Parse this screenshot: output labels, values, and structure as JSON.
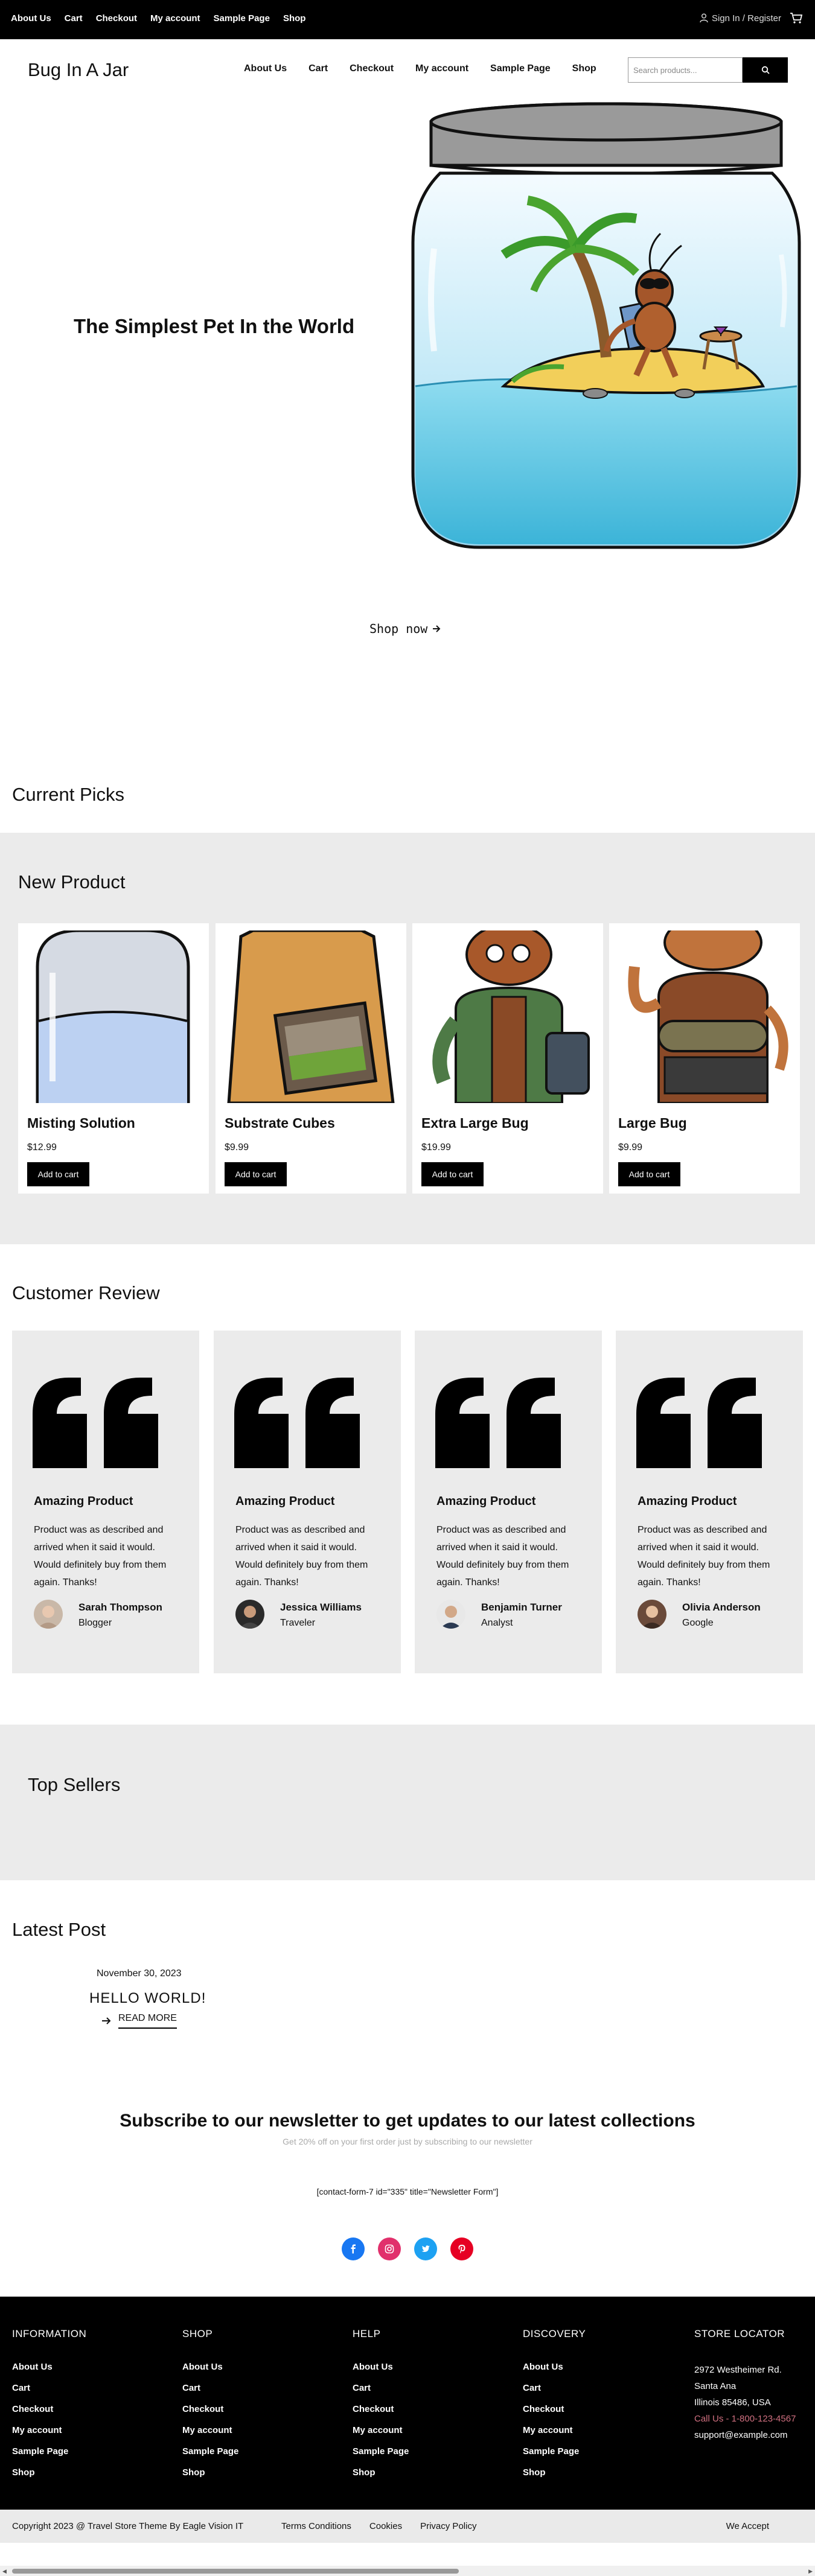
{
  "topbar": {
    "links": [
      "About Us",
      "Cart",
      "Checkout",
      "My account",
      "Sample Page",
      "Shop"
    ],
    "signin": "Sign In / Register",
    "cart_icon": "cart-icon",
    "user_icon": "user-icon"
  },
  "header": {
    "brand": "Bug In A Jar",
    "nav": [
      "About Us",
      "Cart",
      "Checkout",
      "My account",
      "Sample Page",
      "Shop"
    ],
    "search_placeholder": "Search products...",
    "search_icon": "search-icon"
  },
  "hero": {
    "title": "The Simplest Pet In the World",
    "cta": "Shop now",
    "cta_icon": "arrow-right-icon"
  },
  "current_picks": {
    "title": "Current Picks"
  },
  "new_product": {
    "title": "New Product",
    "products": [
      {
        "name": "Misting Solution",
        "price": "$12.99",
        "button": "Add to cart"
      },
      {
        "name": "Substrate Cubes",
        "price": "$9.99",
        "button": "Add to cart"
      },
      {
        "name": "Extra Large Bug",
        "price": "$19.99",
        "button": "Add to cart"
      },
      {
        "name": "Large Bug",
        "price": "$9.99",
        "button": "Add to cart"
      }
    ]
  },
  "reviews": {
    "title": "Customer Review",
    "items": [
      {
        "title": "Amazing Product",
        "text": "Product was as described and arrived when it said it would. Would definitely buy from them again. Thanks!",
        "name": "Sarah Thompson",
        "role": "Blogger"
      },
      {
        "title": "Amazing Product",
        "text": "Product was as described and arrived when it said it would. Would definitely buy from them again. Thanks!",
        "name": "Jessica Williams",
        "role": "Traveler"
      },
      {
        "title": "Amazing Product",
        "text": "Product was as described and arrived when it said it would. Would definitely buy from them again. Thanks!",
        "name": "Benjamin Turner",
        "role": "Analyst"
      },
      {
        "title": "Amazing Product",
        "text": "Product was as described and arrived when it said it would. Would definitely buy from them again. Thanks!",
        "name": "Olivia Anderson",
        "role": "Google"
      }
    ]
  },
  "top_sellers": {
    "title": "Top Sellers"
  },
  "latest_post": {
    "title": "Latest Post",
    "date": "November 30, 2023",
    "post_title": "HELLO WORLD!",
    "read_more": "READ MORE"
  },
  "newsletter": {
    "title": "Subscribe to our newsletter to get updates to our latest collections",
    "subtitle": "Get 20% off on your first order just by subscribing to our newsletter",
    "form": "[contact-form-7 id=\"335\" title=\"Newsletter Form\"]",
    "socials": [
      "facebook-icon",
      "instagram-icon",
      "twitter-icon",
      "pinterest-icon"
    ]
  },
  "footer": {
    "columns": [
      {
        "heading": "INFORMATION",
        "links": [
          "About Us",
          "Cart",
          "Checkout",
          "My account",
          "Sample Page",
          "Shop"
        ]
      },
      {
        "heading": "SHOP",
        "links": [
          "About Us",
          "Cart",
          "Checkout",
          "My account",
          "Sample Page",
          "Shop"
        ]
      },
      {
        "heading": "HELP",
        "links": [
          "About Us",
          "Cart",
          "Checkout",
          "My account",
          "Sample Page",
          "Shop"
        ]
      },
      {
        "heading": "DISCOVERY",
        "links": [
          "About Us",
          "Cart",
          "Checkout",
          "My account",
          "Sample Page",
          "Shop"
        ]
      }
    ],
    "store": {
      "heading": "STORE LOCATOR",
      "address1": "2972 Westheimer Rd.",
      "address2": "Santa Ana",
      "address3": "Illinois 85486, USA",
      "phone": "Call Us - 1-800-123-4567",
      "email": "support@example.com"
    }
  },
  "bottom": {
    "copyright": "Copyright 2023 @ Travel Store Theme By Eagle Vision IT",
    "links": [
      "Terms Conditions",
      "Cookies",
      "Privacy Policy"
    ],
    "accept": "We Accept"
  },
  "colors": {
    "black": "#000000",
    "section_gray": "#ebebeb",
    "facebook": "#1877f2",
    "instagram": "#e1306c",
    "twitter": "#1da1f2",
    "pinterest": "#e60023"
  }
}
